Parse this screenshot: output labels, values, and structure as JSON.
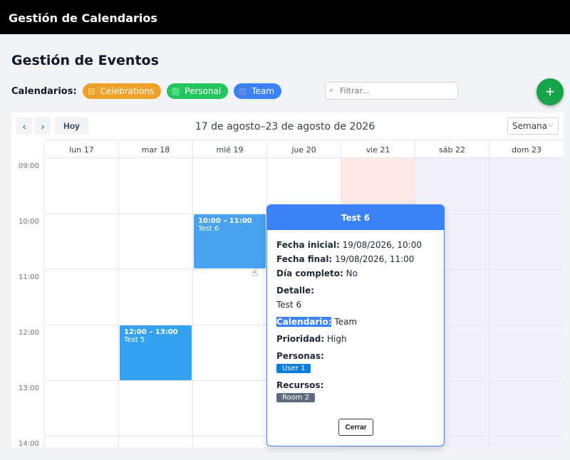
{
  "app": {
    "title": "Gestión de Calendarios"
  },
  "page": {
    "title": "Gestión de Eventos"
  },
  "calendars": {
    "label": "Calendarios:",
    "items": [
      {
        "name": "Celebrations",
        "color": "#f0a12a",
        "box": "#f5b84a"
      },
      {
        "name": "Personal",
        "color": "#22c55e",
        "box": "#4ade80"
      },
      {
        "name": "Team",
        "color": "#3b82f6",
        "box": "#5b8def"
      }
    ]
  },
  "filter": {
    "placeholder": "Filtrar..."
  },
  "add_button": {
    "label": "+"
  },
  "toolbar": {
    "prev_label": "‹",
    "next_label": "›",
    "today_label": "Hoy",
    "range": "17 de agosto–23 de agosto de 2026",
    "view": "Semana",
    "view_chevron": "⌵"
  },
  "days": [
    "lun 17",
    "mar 18",
    "mié 19",
    "jue 20",
    "vie 21",
    "sáb 22",
    "dom 23"
  ],
  "times": [
    "09:00",
    "10:00",
    "11:00",
    "12:00",
    "13:00",
    "14:00"
  ],
  "events": [
    {
      "time": "10:00 – 11:00",
      "title": "Test 6",
      "color": "#4aa3ef"
    },
    {
      "time": "12:00 – 13:00",
      "title": "Test 5",
      "color": "#34a2f0"
    }
  ],
  "popup": {
    "title": "Test 6",
    "start_label": "Fecha inicial:",
    "start_value": "19/08/2026, 10:00",
    "end_label": "Fecha final:",
    "end_value": "19/08/2026, 11:00",
    "allday_label": "Día completo:",
    "allday_value": "No",
    "detail_label": "Detalle:",
    "detail_value": "Test 6",
    "calendar_label": "Calendario:",
    "calendar_value": "Team",
    "priority_label": "Prioridad:",
    "priority_value": "High",
    "people_label": "Personas:",
    "people": [
      "User 1"
    ],
    "resources_label": "Recursos:",
    "resources": [
      "Room 2"
    ],
    "close_label": "Cerrar"
  },
  "colors": {
    "today_bg": "#fde8e6",
    "weekend_bg": "#f3f0fd",
    "people_tag": "#0b7dda",
    "resource_tag": "#5f6b7e"
  }
}
